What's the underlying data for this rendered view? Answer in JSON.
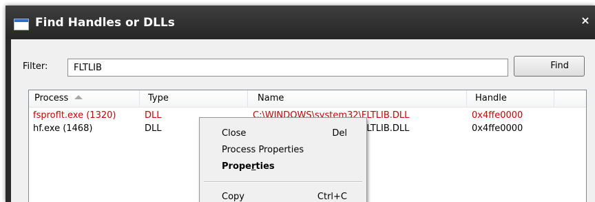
{
  "window": {
    "title": "Find Handles or DLLs",
    "close_glyph": "×"
  },
  "filter": {
    "label": "Filter:",
    "value": "FLTLIB"
  },
  "find_button": {
    "label": "Find"
  },
  "columns": [
    {
      "label": "Process",
      "sorted": "ascending"
    },
    {
      "label": "Type"
    },
    {
      "label": "Name"
    },
    {
      "label": "Handle"
    }
  ],
  "rows": [
    {
      "process": "fsproflt.exe (1320)",
      "type": "DLL",
      "name": "C:\\WINDOWS\\system32\\FLTLIB.DLL",
      "handle": "0x4ffe0000",
      "color": "#cc0000"
    },
    {
      "process": "hf.exe (1468)",
      "type": "DLL",
      "name": "C:\\WINDOWS\\system32\\FLTLIB.DLL",
      "handle": "0x4ffe0000",
      "color": "#000000"
    }
  ],
  "context_menu": {
    "items": [
      {
        "label": "Close",
        "shortcut": "Del"
      },
      {
        "label": "Process Properties",
        "shortcut": ""
      },
      {
        "label": "Properties",
        "shortcut": "",
        "bold": true,
        "mnemonic": "r"
      },
      {
        "label": "Copy",
        "shortcut": "Ctrl+C"
      }
    ]
  },
  "colors": {
    "titlebar": "#2a2a2a",
    "client_background": "#f0f0f0",
    "highlight_row_text": "#cc0000"
  },
  "icons": {
    "title": "window-icon",
    "sort": "sort-ascending-arrow"
  }
}
